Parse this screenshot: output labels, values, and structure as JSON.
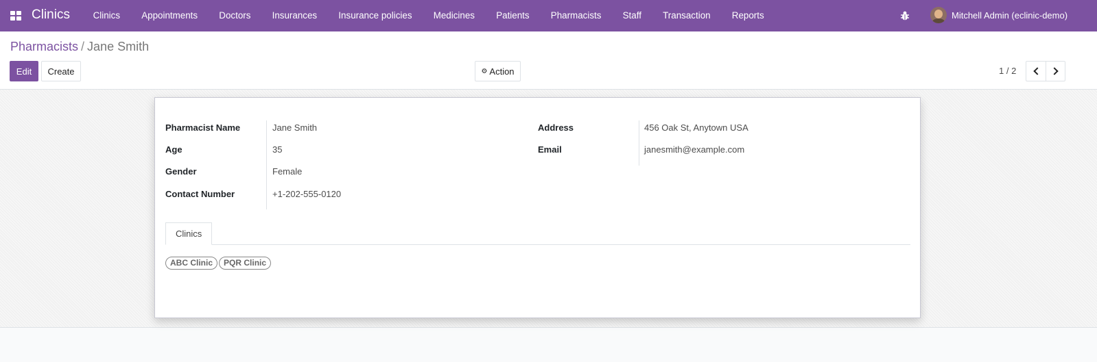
{
  "navbar": {
    "brand": "Clinics",
    "menu": [
      "Clinics",
      "Appointments",
      "Doctors",
      "Insurances",
      "Insurance policies",
      "Medicines",
      "Patients",
      "Pharmacists",
      "Staff",
      "Transaction",
      "Reports"
    ],
    "user_name": "Mitchell Admin (eclinic-demo)",
    "color": "#7c52a1"
  },
  "breadcrumb": {
    "parent": "Pharmacists",
    "separator": "/",
    "current": "Jane Smith"
  },
  "buttons": {
    "edit": "Edit",
    "create": "Create",
    "action": "Action"
  },
  "pager": {
    "value": "1 / 2"
  },
  "form": {
    "left_fields": [
      {
        "label": "Pharmacist Name",
        "value": "Jane Smith"
      },
      {
        "label": "Age",
        "value": "35"
      },
      {
        "label": "Gender",
        "value": "Female"
      },
      {
        "label": "Contact Number",
        "value": "+1-202-555-0120"
      }
    ],
    "right_fields": [
      {
        "label": "Address",
        "value": "456 Oak St, Anytown USA"
      },
      {
        "label": "Email",
        "value": "janesmith@example.com"
      }
    ],
    "tabs": [
      "Clinics"
    ],
    "tags": [
      "ABC Clinic",
      "PQR Clinic"
    ]
  },
  "icons": {
    "apps": "apps-grid-icon",
    "debug": "bug-icon",
    "gear": "gear-icon",
    "prev": "chevron-left-icon",
    "next": "chevron-right-icon"
  }
}
